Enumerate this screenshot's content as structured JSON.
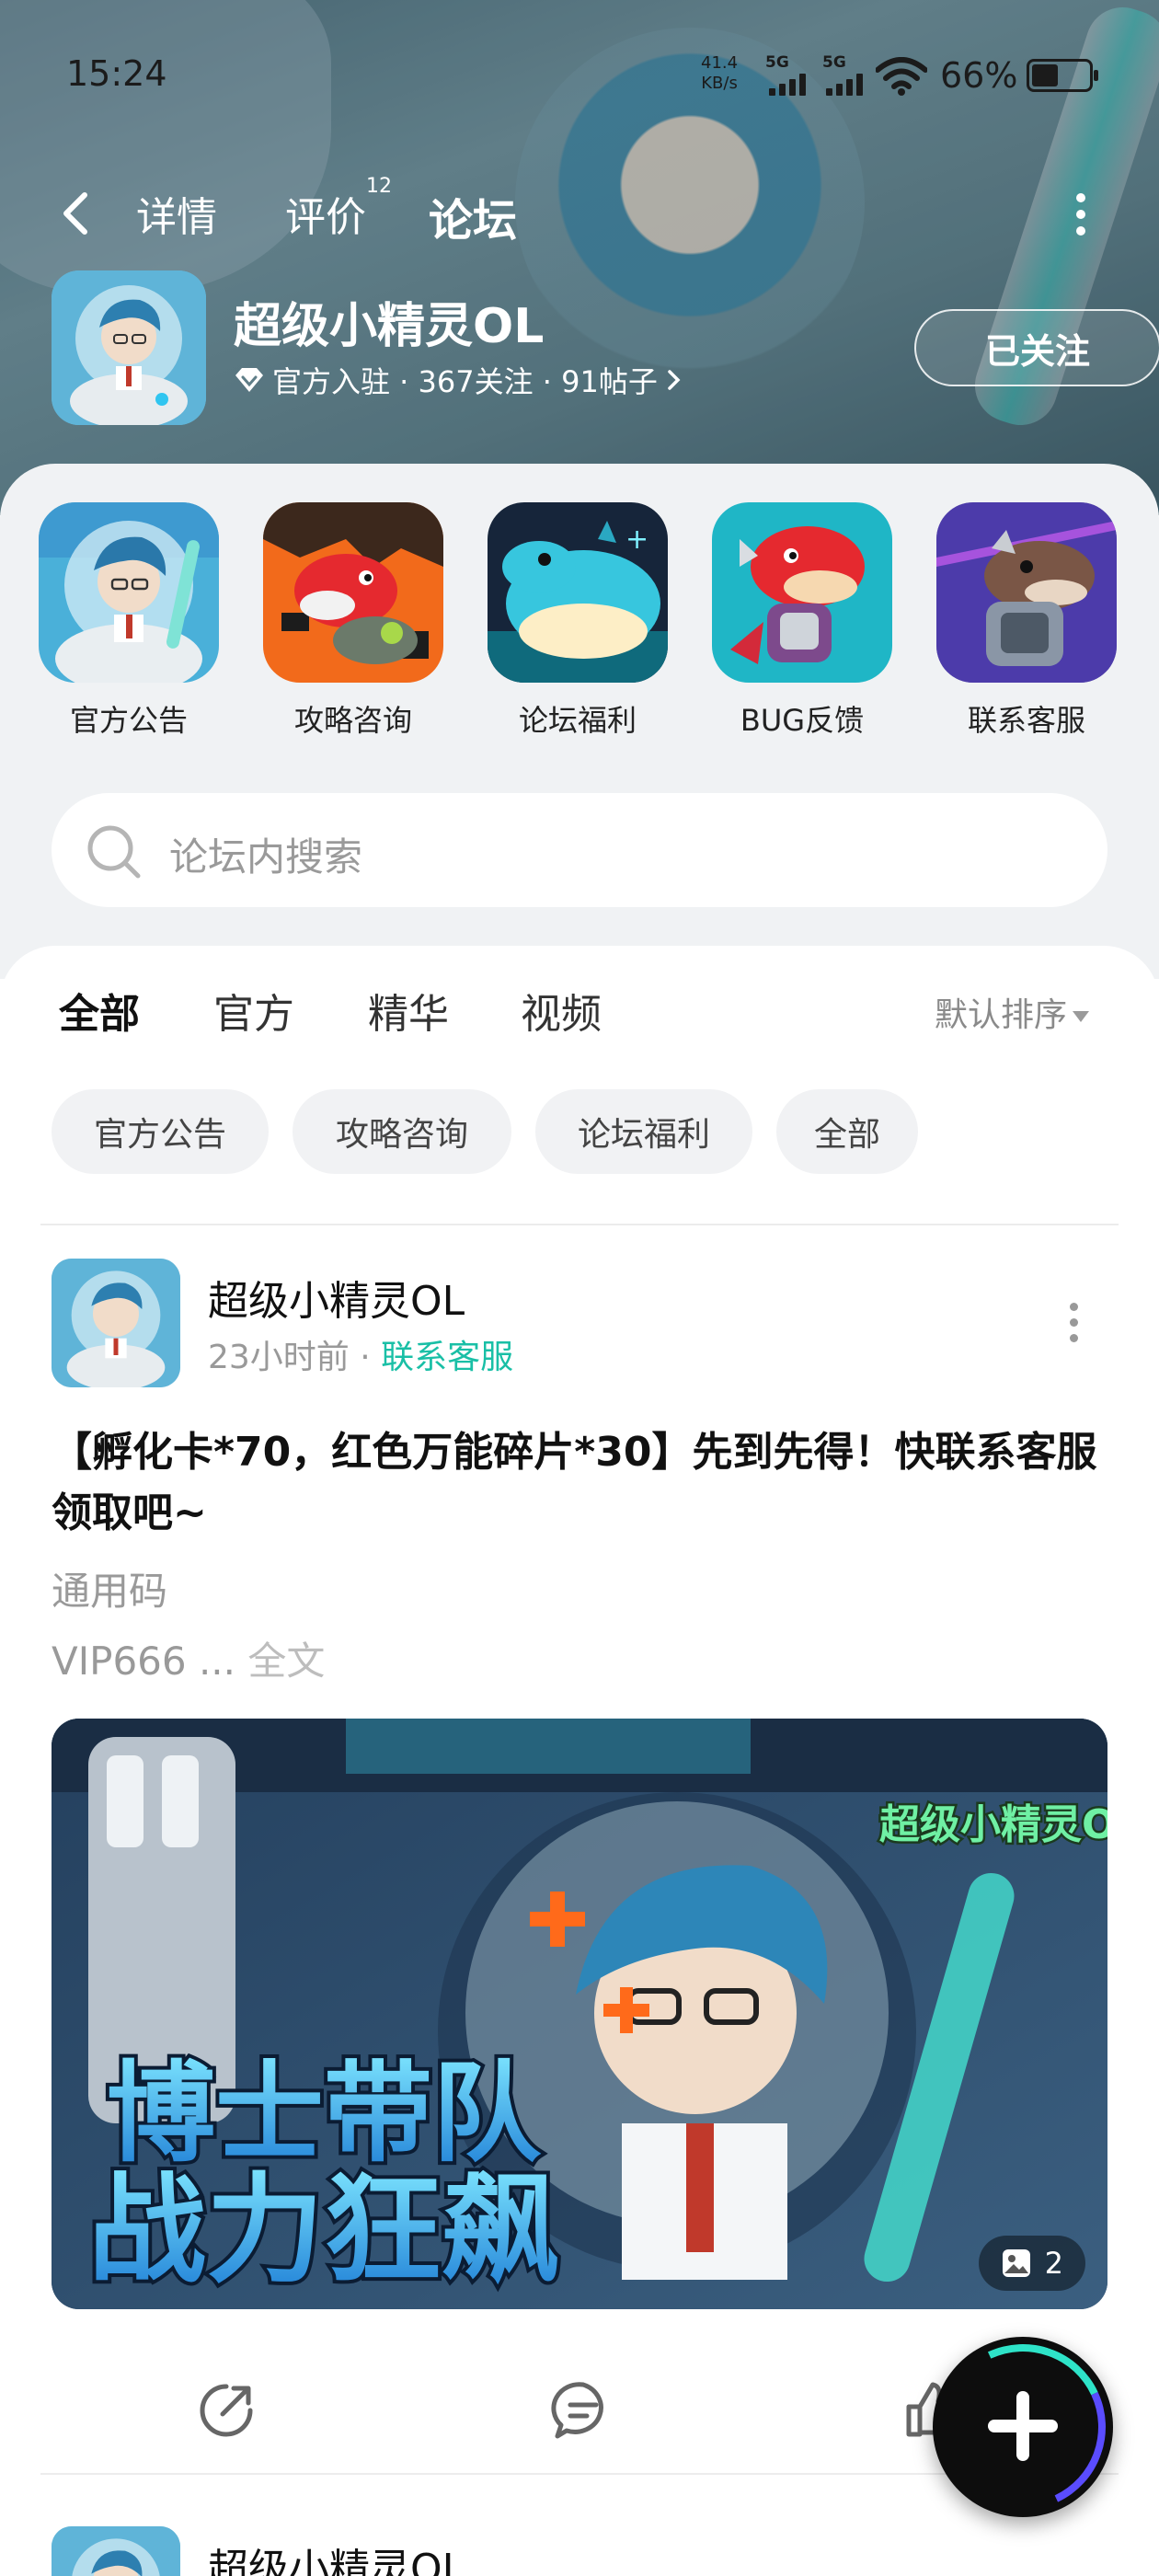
{
  "status_bar": {
    "time": "15:24",
    "net_speed_value": "41.4",
    "net_speed_unit": "KB/s",
    "signal1": "5G",
    "signal2": "5G",
    "battery": "66%"
  },
  "nav": {
    "tabs": [
      {
        "label": "详情"
      },
      {
        "label": "评价",
        "badge": "12"
      },
      {
        "label": "论坛"
      }
    ],
    "active_tab": "论坛"
  },
  "game": {
    "name": "超级小精灵OL",
    "meta": "官方入驻 · 367关注 · 91帖子",
    "follow_label": "已关注"
  },
  "categories": [
    {
      "label": "官方公告",
      "icon": "doctor-character-icon"
    },
    {
      "label": "攻略咨询",
      "icon": "red-dragon-icon"
    },
    {
      "label": "论坛福利",
      "icon": "cyan-dino-icon"
    },
    {
      "label": "BUG反馈",
      "icon": "red-dragon-mecha-icon"
    },
    {
      "label": "联系客服",
      "icon": "brown-dino-icon"
    }
  ],
  "search": {
    "placeholder": "论坛内搜索"
  },
  "feed_tabs": [
    {
      "label": "全部"
    },
    {
      "label": "官方"
    },
    {
      "label": "精华"
    },
    {
      "label": "视频"
    }
  ],
  "sort": {
    "label": "默认排序"
  },
  "chips": [
    {
      "label": "官方公告"
    },
    {
      "label": "攻略咨询"
    },
    {
      "label": "论坛福利"
    },
    {
      "label": "全部"
    }
  ],
  "post": {
    "author": "超级小精灵OL",
    "time": "23小时前 · ",
    "tag": "联系客服",
    "title": "【孵化卡*70，红色万能碎片*30】先到先得！快联系客服领取吧~",
    "line1": "通用码",
    "line2": "VIP666 ... ",
    "full_text": "全文",
    "image_text_top": "博士带队",
    "image_text_bottom": "战力狂飙",
    "image_logo": "超级小精灵OL",
    "image_count": "2"
  },
  "post2": {
    "author": "超级小精灵OL"
  },
  "colors": {
    "accent": "#2ee3c8",
    "tag": "#19bfa6",
    "page_bg": "#f0f2f4"
  }
}
